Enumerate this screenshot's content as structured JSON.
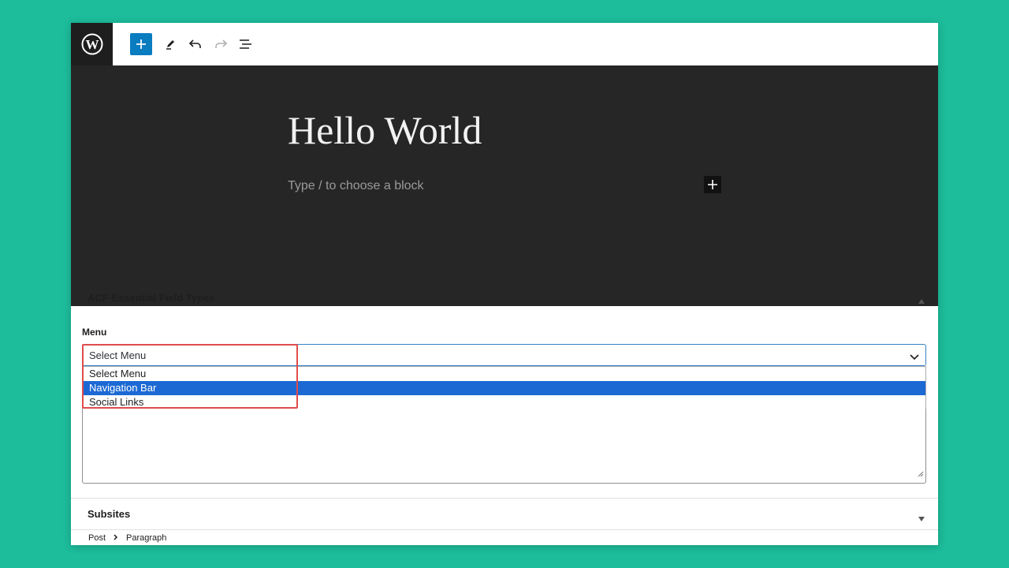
{
  "toolbar": {
    "logo_icon": "wordpress-logo-icon",
    "add_icon": "plus-icon",
    "tools_icon": "pencil-icon",
    "undo_icon": "undo-icon",
    "redo_icon": "redo-icon",
    "list_view_icon": "list-view-icon",
    "accent_color": "#0a7cc0"
  },
  "editor": {
    "title": "Hello World",
    "block_placeholder": "Type / to choose a block"
  },
  "metabox": {
    "title": "ACF Essential Field Types",
    "menu_label": "Menu",
    "select": {
      "value": "Select Menu",
      "options": [
        "Select Menu",
        "Navigation Bar",
        "Social Links"
      ],
      "highlighted": "Navigation Bar"
    }
  },
  "subsites": {
    "title": "Subsites"
  },
  "breadcrumb": {
    "items": [
      "Post",
      "Paragraph"
    ]
  }
}
